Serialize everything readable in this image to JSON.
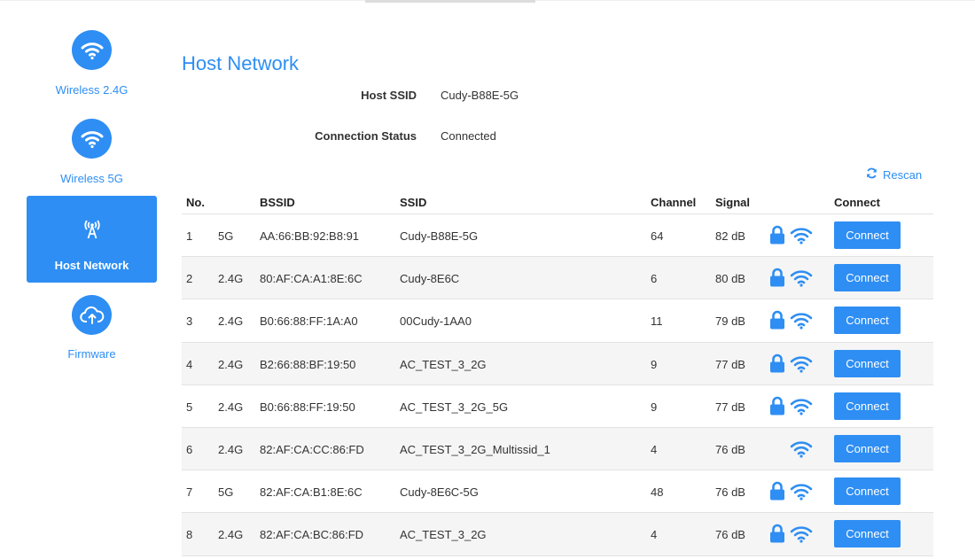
{
  "sidebar": {
    "items": [
      {
        "label": "Wireless 2.4G",
        "icon": "wifi-icon",
        "active": false
      },
      {
        "label": "Wireless 5G",
        "icon": "wifi-icon",
        "active": false
      },
      {
        "label": "Host Network",
        "icon": "antenna-icon",
        "active": true
      },
      {
        "label": "Firmware",
        "icon": "cloud-upload-icon",
        "active": false
      }
    ]
  },
  "main": {
    "title": "Host Network",
    "host_ssid_label": "Host SSID",
    "host_ssid_value": "Cudy-B88E-5G",
    "status_label": "Connection Status",
    "status_value": "Connected",
    "rescan_label": "Rescan"
  },
  "table": {
    "headers": {
      "no": "No.",
      "bssid": "BSSID",
      "ssid": "SSID",
      "channel": "Channel",
      "signal": "Signal",
      "connect": "Connect"
    },
    "rows": [
      {
        "no": "1",
        "band": "5G",
        "bssid": "AA:66:BB:92:B8:91",
        "ssid": "Cudy-B88E-5G",
        "channel": "64",
        "signal": "82 dB",
        "locked": true,
        "button": "Connect"
      },
      {
        "no": "2",
        "band": "2.4G",
        "bssid": "80:AF:CA:A1:8E:6C",
        "ssid": "Cudy-8E6C",
        "channel": "6",
        "signal": "80 dB",
        "locked": true,
        "button": "Connect"
      },
      {
        "no": "3",
        "band": "2.4G",
        "bssid": "B0:66:88:FF:1A:A0",
        "ssid": "00Cudy-1AA0",
        "channel": "11",
        "signal": "79 dB",
        "locked": true,
        "button": "Connect"
      },
      {
        "no": "4",
        "band": "2.4G",
        "bssid": "B2:66:88:BF:19:50",
        "ssid": "AC_TEST_3_2G",
        "channel": "9",
        "signal": "77 dB",
        "locked": true,
        "button": "Connect"
      },
      {
        "no": "5",
        "band": "2.4G",
        "bssid": "B0:66:88:FF:19:50",
        "ssid": "AC_TEST_3_2G_5G",
        "channel": "9",
        "signal": "77 dB",
        "locked": true,
        "button": "Connect"
      },
      {
        "no": "6",
        "band": "2.4G",
        "bssid": "82:AF:CA:CC:86:FD",
        "ssid": "AC_TEST_3_2G_Multissid_1",
        "channel": "4",
        "signal": "76 dB",
        "locked": false,
        "button": "Connect"
      },
      {
        "no": "7",
        "band": "5G",
        "bssid": "82:AF:CA:B1:8E:6C",
        "ssid": "Cudy-8E6C-5G",
        "channel": "48",
        "signal": "76 dB",
        "locked": true,
        "button": "Connect"
      },
      {
        "no": "8",
        "band": "2.4G",
        "bssid": "82:AF:CA:BC:86:FD",
        "ssid": "AC_TEST_3_2G",
        "channel": "4",
        "signal": "76 dB",
        "locked": true,
        "button": "Connect"
      }
    ]
  },
  "colors": {
    "accent": "#2e8ef3",
    "row_alt": "#f5f5f5",
    "divider": "#e3e3e3"
  }
}
